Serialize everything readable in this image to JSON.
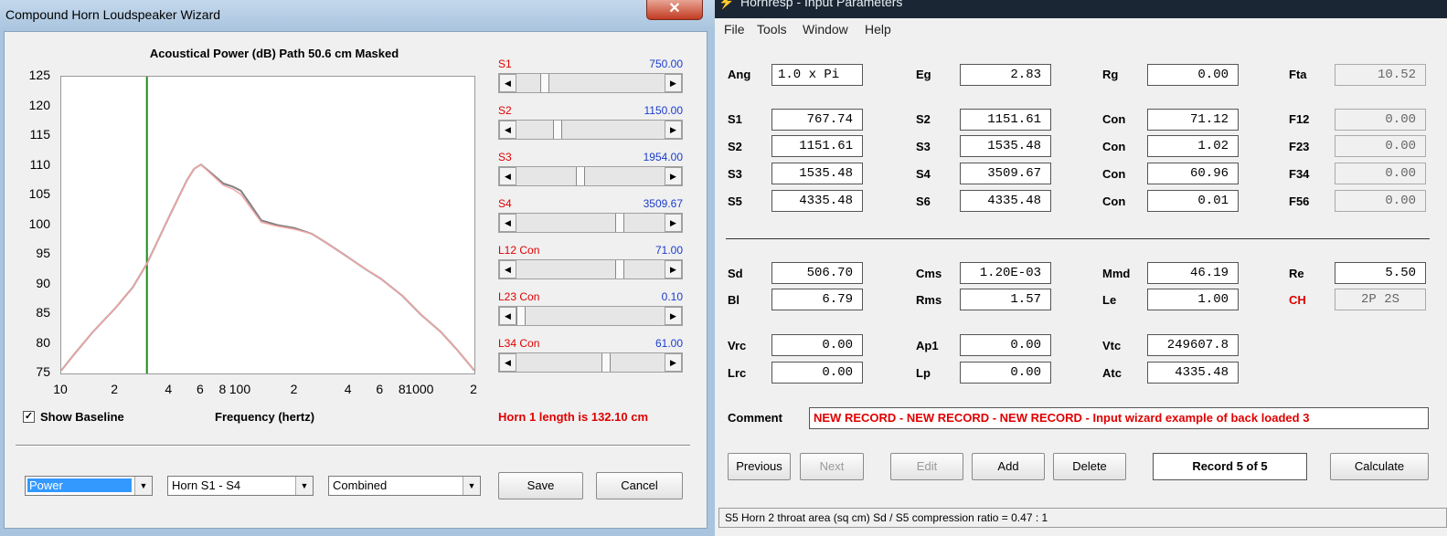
{
  "wizard": {
    "title": "Compound Horn Loudspeaker Wizard",
    "close_glyph": "✕",
    "chart_title": "Acoustical Power (dB)   Path 50.6 cm   Masked",
    "show_baseline_label": "Show Baseline",
    "show_baseline_checked": true,
    "horn_length_text": "Horn 1 length is 132.10 cm",
    "sliders": [
      {
        "label": "S1",
        "value": "750.00",
        "position": 0.17
      },
      {
        "label": "S2",
        "value": "1150.00",
        "position": 0.26
      },
      {
        "label": "S3",
        "value": "1954.00",
        "position": 0.43
      },
      {
        "label": "S4",
        "value": "3509.67",
        "position": 0.71
      },
      {
        "label": "L12  Con",
        "value": "71.00",
        "position": 0.71
      },
      {
        "label": "L23  Con",
        "value": "0.10",
        "position": 0.0
      },
      {
        "label": "L34  Con",
        "value": "61.00",
        "position": 0.61
      }
    ],
    "combo_power": "Power",
    "combo_horn": "Horn S1 - S4",
    "combo_combined": "Combined",
    "save_label": "Save",
    "cancel_label": "Cancel"
  },
  "chart_data": {
    "type": "line",
    "title": "Acoustical Power (dB)   Path 50.6 cm   Masked",
    "xlabel": "Frequency (hertz)",
    "ylabel": "",
    "xscale": "log",
    "xlim": [
      10,
      2000
    ],
    "ylim": [
      75,
      125
    ],
    "yticks": [
      "125",
      "120",
      "115",
      "110",
      "105",
      "100",
      "95",
      "90",
      "85",
      "80",
      "75"
    ],
    "xticks": [
      "10",
      "2",
      "4",
      "6",
      "8",
      "100",
      "2",
      "4",
      "6",
      "8",
      "1000",
      "2"
    ],
    "marker_x": 30,
    "marker_color": "#1f8a1f",
    "grid": false,
    "series": [
      {
        "color": "#808080",
        "x": [
          10,
          12,
          15,
          20,
          25,
          30,
          40,
          50,
          55,
          60,
          70,
          80,
          90,
          100,
          110,
          130,
          160,
          200,
          250,
          300,
          400,
          500,
          600,
          800,
          1000,
          1300,
          1600,
          2000
        ],
        "y": [
          75.5,
          78.5,
          82,
          86,
          89.5,
          93.5,
          101.5,
          107.5,
          109.5,
          110.2,
          108.5,
          107,
          106.5,
          105.8,
          104,
          100.8,
          100,
          99.5,
          98.5,
          97,
          94.5,
          92.5,
          91,
          88,
          85,
          82,
          79,
          75.5
        ]
      },
      {
        "color": "#f2a6a6",
        "x": [
          10,
          12,
          15,
          20,
          25,
          30,
          40,
          50,
          55,
          60,
          70,
          80,
          90,
          100,
          110,
          130,
          160,
          200,
          250,
          300,
          400,
          500,
          600,
          800,
          1000,
          1300,
          1600,
          2000
        ],
        "y": [
          75.5,
          78.5,
          82,
          86,
          89.5,
          93.5,
          101.5,
          107.5,
          109.5,
          110.2,
          108.3,
          106.7,
          106.1,
          105.2,
          103.5,
          100.5,
          99.8,
          99.3,
          98.5,
          97,
          94.5,
          92.5,
          91,
          88,
          85,
          82,
          79,
          75.5
        ]
      }
    ]
  },
  "hornresp": {
    "title": "Hornresp - Input Parameters",
    "bolt_glyph": "⚡",
    "menu": [
      "File",
      "Tools",
      "Window",
      "Help"
    ],
    "fields": {
      "ang": {
        "label": "Ang",
        "value": "1.0 x Pi"
      },
      "eg": {
        "label": "Eg",
        "value": "2.83"
      },
      "rg": {
        "label": "Rg",
        "value": "0.00"
      },
      "fta": {
        "label": "Fta",
        "value": "10.52"
      },
      "s1": {
        "label": "S1",
        "value": "767.74"
      },
      "s2a": {
        "label": "S2",
        "value": "1151.61"
      },
      "con1": {
        "label": "Con",
        "value": "71.12"
      },
      "f12": {
        "label": "F12",
        "value": "0.00"
      },
      "s2b": {
        "label": "S2",
        "value": "1151.61"
      },
      "s3a": {
        "label": "S3",
        "value": "1535.48"
      },
      "con2": {
        "label": "Con",
        "value": "1.02"
      },
      "f23": {
        "label": "F23",
        "value": "0.00"
      },
      "s3b": {
        "label": "S3",
        "value": "1535.48"
      },
      "s4": {
        "label": "S4",
        "value": "3509.67"
      },
      "con3": {
        "label": "Con",
        "value": "60.96"
      },
      "f34": {
        "label": "F34",
        "value": "0.00"
      },
      "s5": {
        "label": "S5",
        "value": "4335.48"
      },
      "s6": {
        "label": "S6",
        "value": "4335.48"
      },
      "con4": {
        "label": "Con",
        "value": "0.01"
      },
      "f56": {
        "label": "F56",
        "value": "0.00"
      },
      "sd": {
        "label": "Sd",
        "value": "506.70"
      },
      "cms": {
        "label": "Cms",
        "value": "1.20E-03"
      },
      "mmd": {
        "label": "Mmd",
        "value": "46.19"
      },
      "re": {
        "label": "Re",
        "value": "5.50"
      },
      "bl": {
        "label": "Bl",
        "value": "6.79"
      },
      "rms": {
        "label": "Rms",
        "value": "1.57"
      },
      "le": {
        "label": "Le",
        "value": "1.00"
      },
      "ch": {
        "label": "CH",
        "value": "2P 2S"
      },
      "vrc": {
        "label": "Vrc",
        "value": "0.00"
      },
      "ap1": {
        "label": "Ap1",
        "value": "0.00"
      },
      "vtc": {
        "label": "Vtc",
        "value": "249607.8"
      },
      "lrc": {
        "label": "Lrc",
        "value": "0.00"
      },
      "lp": {
        "label": "Lp",
        "value": "0.00"
      },
      "atc": {
        "label": "Atc",
        "value": "4335.48"
      }
    },
    "comment_label": "Comment",
    "comment_value": "NEW RECORD - NEW RECORD - NEW RECORD - Input wizard example of back loaded 3",
    "buttons": {
      "previous": "Previous",
      "next": "Next",
      "edit": "Edit",
      "add": "Add",
      "delete": "Delete",
      "calculate": "Calculate"
    },
    "record_text": "Record 5 of 5",
    "status_text": "S5   Horn 2 throat area  (sq cm)   Sd / S5 compression ratio = 0.47 : 1"
  },
  "colors": {
    "accent_red": "#e00000",
    "accent_blue": "#1a3ccc",
    "selection": "#3399ff"
  }
}
